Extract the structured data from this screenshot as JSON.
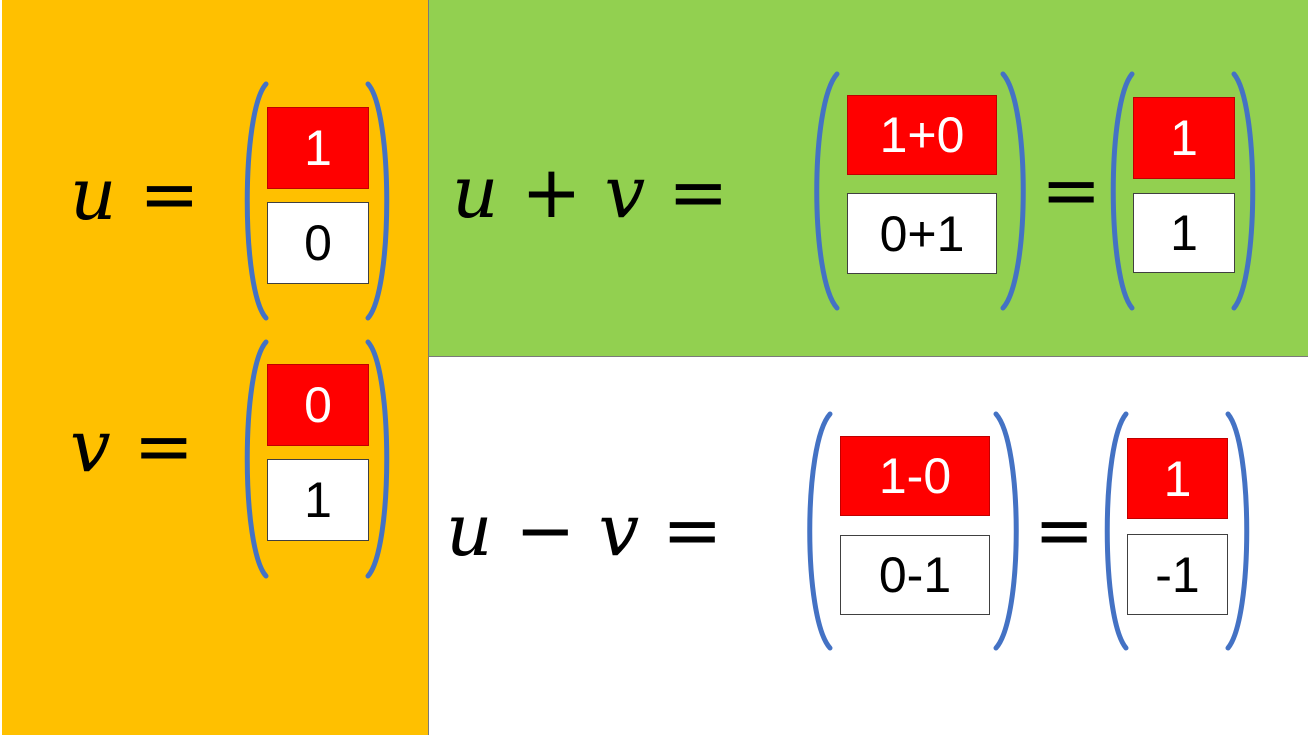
{
  "definitions": {
    "u": {
      "label": "u",
      "equals": "=",
      "top": "1",
      "bottom": "0"
    },
    "v": {
      "label": "v",
      "equals": "=",
      "top": "0",
      "bottom": "1"
    }
  },
  "sum": {
    "lhs_a": "u",
    "operator": "+",
    "lhs_b": "v",
    "equals": "=",
    "expr_top": "1+0",
    "expr_bottom": "0+1",
    "equals2": "=",
    "result_top": "1",
    "result_bottom": "1"
  },
  "difference": {
    "lhs_a": "u",
    "operator": "−",
    "lhs_b": "v",
    "equals": "=",
    "expr_top": "1-0",
    "expr_bottom": "0-1",
    "equals2": "=",
    "result_top": "1",
    "result_bottom": "-1"
  },
  "colors": {
    "left_panel": "#FFC000",
    "sum_panel": "#92D050",
    "difference_panel": "#FFFFFF",
    "top_component": "#FF0000",
    "bracket": "#4472C4"
  }
}
